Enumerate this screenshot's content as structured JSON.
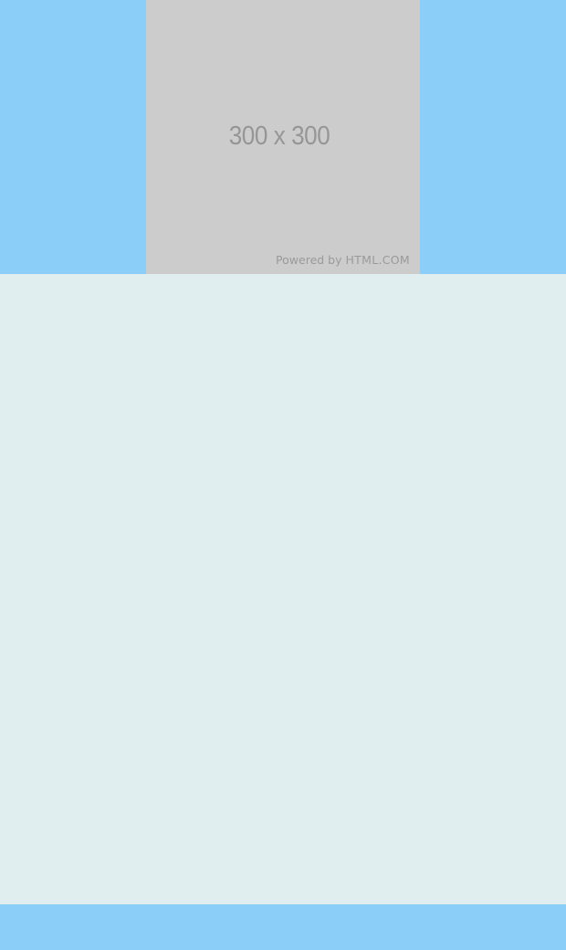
{
  "ad": {
    "size_text": "300 x 300",
    "powered_prefix": "Powered by",
    "powered_brand": "HTML.COM"
  },
  "palette": {
    "background": "#e0eef0",
    "sky": "#8bcff8",
    "placeholder": "#cccccc",
    "steel_blue": "#4e8baf",
    "navy_blue": "#43668c",
    "coral": "#ee6764",
    "peach": "#ffa571"
  },
  "stripes": [
    {
      "color": "#4e8baf"
    },
    {
      "color": "#43668c"
    },
    {
      "color": "#ee6764"
    },
    {
      "color": "#ffa571"
    }
  ],
  "circles": [
    {
      "color": "#4e8baf"
    },
    {
      "color": "#43668c"
    },
    {
      "color": "#ee6764"
    },
    {
      "color": "#ffa571"
    }
  ]
}
